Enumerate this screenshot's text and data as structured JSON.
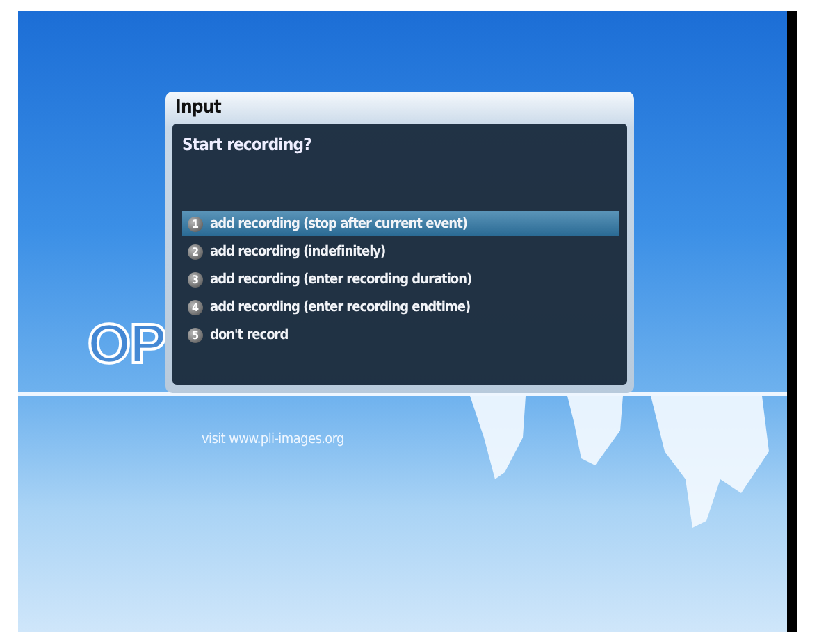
{
  "background": {
    "logo": "OP",
    "footer": "visit www.pli-images.org"
  },
  "dialog": {
    "title": "Input",
    "question": "Start recording?",
    "items": [
      {
        "number": "1",
        "label": "add recording (stop after current event)",
        "selected": true
      },
      {
        "number": "2",
        "label": "add recording (indefinitely)",
        "selected": false
      },
      {
        "number": "3",
        "label": "add recording (enter recording duration)",
        "selected": false
      },
      {
        "number": "4",
        "label": "add recording (enter recording endtime)",
        "selected": false
      },
      {
        "number": "5",
        "label": "don't record",
        "selected": false
      }
    ]
  }
}
